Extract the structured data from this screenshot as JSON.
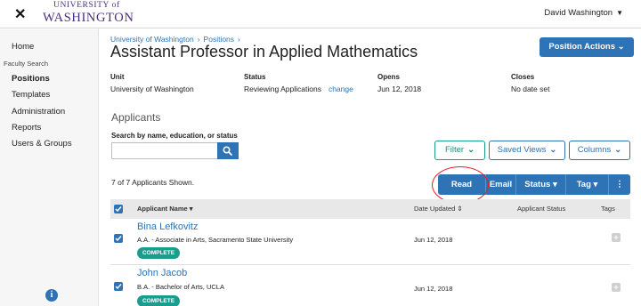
{
  "header": {
    "logo_line1": "UNIVERSITY of",
    "logo_line2": "WASHINGTON",
    "user_name": "David Washington"
  },
  "sidebar": {
    "items": [
      {
        "label": "Home"
      },
      {
        "label": "Faculty Search"
      },
      {
        "label": "Positions"
      },
      {
        "label": "Templates"
      },
      {
        "label": "Administration"
      },
      {
        "label": "Reports"
      },
      {
        "label": "Users & Groups"
      }
    ]
  },
  "breadcrumb": [
    "University of Washington",
    "Positions"
  ],
  "page": {
    "title": "Assistant Professor in Applied Mathematics",
    "actions_label": "Position Actions"
  },
  "meta": {
    "unit_label": "Unit",
    "unit_value": "University of Washington",
    "status_label": "Status",
    "status_value": "Reviewing Applications",
    "status_link": "change",
    "opens_label": "Opens",
    "opens_value": "Jun 12, 2018",
    "closes_label": "Closes",
    "closes_value": "No date set"
  },
  "applicants": {
    "section_title": "Applicants",
    "search_label": "Search by name, education, or status",
    "search_value": "",
    "filter_label": "Filter",
    "saved_views_label": "Saved Views",
    "columns_label": "Columns",
    "count_text": "7 of 7 Applicants Shown.",
    "toolbar": {
      "read": "Read",
      "email": "Email",
      "status": "Status",
      "tag": "Tag",
      "more": "⋮"
    },
    "columns": {
      "name": "Applicant Name",
      "date": "Date Updated",
      "status": "Applicant Status",
      "tags": "Tags"
    },
    "rows": [
      {
        "name": "Bina Lefkovitz",
        "education": "A.A. - Associate in Arts, Sacramento State University",
        "badge": "COMPLETE",
        "date": "Jun 12, 2018"
      },
      {
        "name": "John Jacob",
        "education": "B.A. - Bachelor of Arts, UCLA",
        "badge": "COMPLETE",
        "date": "Jun 12, 2018"
      }
    ]
  },
  "colors": {
    "primary": "#2d73b5",
    "teal": "#1a9d8f",
    "annotation_red": "#e21c23"
  }
}
